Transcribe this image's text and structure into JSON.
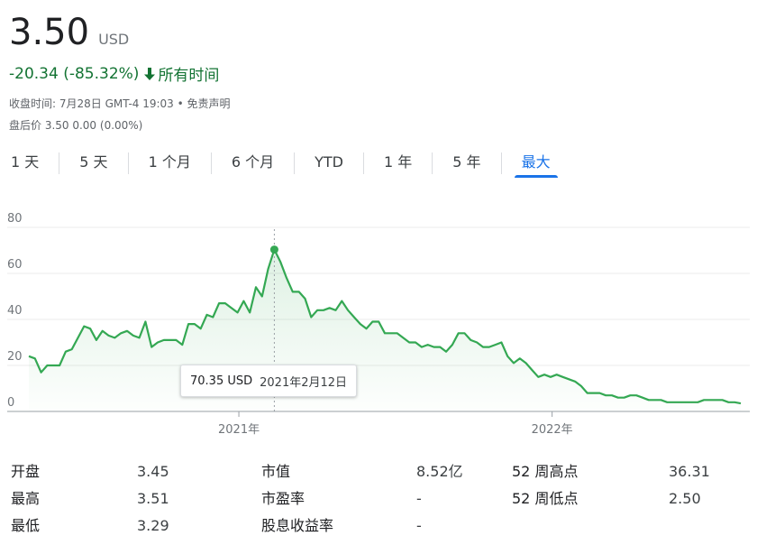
{
  "quote": {
    "price": "3.50",
    "currency": "USD",
    "change": "-20.34 (-85.32%)",
    "change_period": "所有时间",
    "close_time": "收盘时间: 7月28日 GMT-4 19:03 • 免责声明",
    "after_hours": "盘后价 3.50 0.00 (0.00%)"
  },
  "tabs": [
    {
      "label": "1 天"
    },
    {
      "label": "5 天"
    },
    {
      "label": "1 个月"
    },
    {
      "label": "6 个月"
    },
    {
      "label": "YTD"
    },
    {
      "label": "1 年"
    },
    {
      "label": "5 年"
    },
    {
      "label": "最大",
      "active": true
    }
  ],
  "tooltip": {
    "value": "70.35 USD",
    "date": "2021年2月12日"
  },
  "colors": {
    "up": "#137333",
    "line": "#34a853",
    "accent": "#1a73e8"
  },
  "chart_data": {
    "type": "area",
    "x_labels": [
      "2021年",
      "2022年"
    ],
    "y_ticks": [
      "0",
      "20",
      "40",
      "60",
      "80"
    ],
    "ylim": [
      0,
      80
    ],
    "grid": true,
    "highlight": {
      "date": "2021年2月12日",
      "value": 70.35
    },
    "values": [
      24,
      23,
      17,
      20,
      20,
      20,
      26,
      27,
      32,
      37,
      36,
      31,
      35,
      33,
      32,
      34,
      35,
      33,
      32,
      39,
      28,
      30,
      31,
      31,
      31,
      29,
      38,
      38,
      36,
      42,
      41,
      47,
      47,
      45,
      43,
      48,
      43,
      54,
      50,
      62,
      70.35,
      65,
      58,
      52,
      52,
      49,
      41,
      44,
      44,
      45,
      44,
      48,
      44,
      41,
      38,
      36,
      39,
      39,
      34,
      34,
      34,
      32,
      30,
      30,
      28,
      29,
      28,
      28,
      26,
      29,
      34,
      34,
      31,
      30,
      28,
      28,
      29,
      30,
      24,
      21,
      23,
      21,
      18,
      15,
      16,
      15,
      16,
      15,
      14,
      13,
      11,
      8,
      8,
      8,
      7,
      7,
      6,
      6,
      7,
      7,
      6,
      5,
      5,
      5,
      4,
      4,
      4,
      4,
      4,
      4,
      5,
      5,
      5,
      5,
      4,
      4,
      3.5
    ]
  },
  "stats": [
    {
      "k1": "开盘",
      "v1": "3.45",
      "k2": "市值",
      "v2": "8.52亿",
      "k3": "52 周高点",
      "v3": "36.31"
    },
    {
      "k1": "最高",
      "v1": "3.51",
      "k2": "市盈率",
      "v2": "-",
      "k3": "52 周低点",
      "v3": "2.50"
    },
    {
      "k1": "最低",
      "v1": "3.29",
      "k2": "股息收益率",
      "v2": "-",
      "k3": "",
      "v3": ""
    }
  ]
}
